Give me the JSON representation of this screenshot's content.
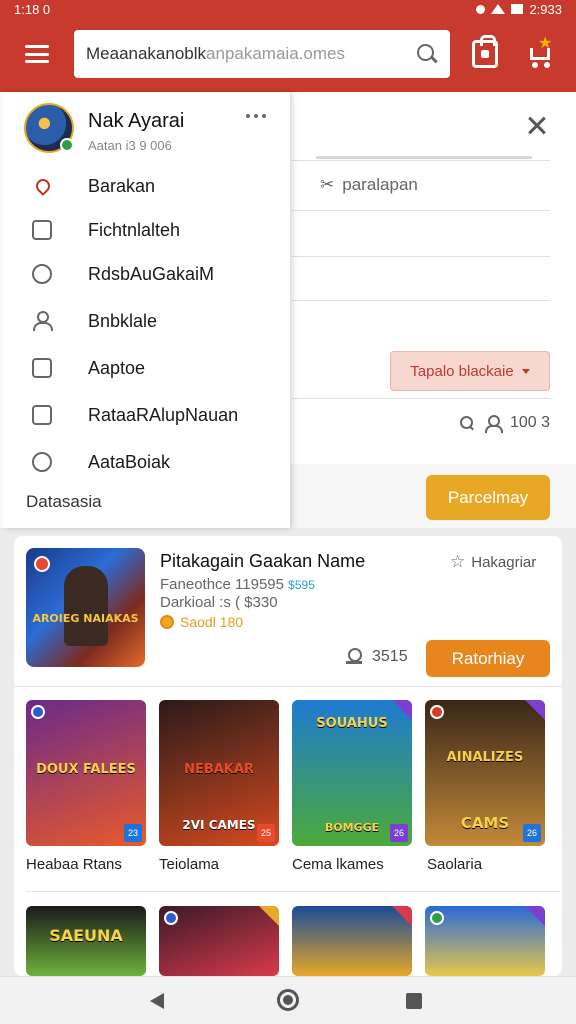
{
  "status_bar": {
    "time": "1:18 0",
    "battery": "2:933"
  },
  "app_bar": {
    "search_value": "Meaanakanoblk",
    "search_placeholder": "anpakamaia.omes"
  },
  "background_panel": {
    "filter_label": "paralapan",
    "sort_label": "Tapalo blackaie",
    "stat_value": "100 3",
    "primary_button": "Parcelmay"
  },
  "drawer": {
    "name": "Nak Ayarai",
    "subtitle": "Aatan i3 9 006",
    "items": [
      {
        "label": "Barakan",
        "icon": "pin-icon"
      },
      {
        "label": "Fichtnlalteh",
        "icon": "document-icon"
      },
      {
        "label": "RdsbAuGakaiM",
        "icon": "chat-icon"
      },
      {
        "label": "Bnbklale",
        "icon": "person-icon"
      },
      {
        "label": "Aaptoe",
        "icon": "image-icon"
      },
      {
        "label": "RataaRAlupNauan",
        "icon": "wallet-icon"
      },
      {
        "label": "AataBoiak",
        "icon": "settings-icon"
      }
    ],
    "footer": "Datasasia"
  },
  "featured": {
    "title": "Pitakagain Gaakan Name",
    "line1": "Faneothce 119595",
    "line1_accent": "$595",
    "line2": "Darkioal :s ( $330",
    "price": "Saodl 180",
    "meta": "Hakagriar",
    "count": "3515",
    "button": "Ratorhiay",
    "thumb_caption": "AROIEG NAIAKAS"
  },
  "games": [
    {
      "title": "DOUX FALEES",
      "label": "Heabaa Rtans",
      "badge": "23",
      "colors": [
        "#6a2a8a",
        "#e85a2a"
      ]
    },
    {
      "title": "NEBAKAR",
      "label": "Teiolama",
      "badge": "25",
      "colors": [
        "#2a1a1a",
        "#d44a1e"
      ]
    },
    {
      "title": "SOUAHUS",
      "label": "Cema lkames",
      "badge": "26",
      "colors": [
        "#1e7ad0",
        "#4caa3a"
      ]
    },
    {
      "title": "AINALIZES",
      "label": "Saolaria",
      "badge": "26",
      "colors": [
        "#3a2618",
        "#c28a3a"
      ]
    }
  ],
  "game_tile_captions": [
    "2VI CAMES",
    "BOMGGE",
    "CAMS"
  ],
  "more_games": [
    {
      "title": "SAEUNA",
      "colors": [
        "#1a1a1a",
        "#6fb13a"
      ]
    },
    {
      "title": "",
      "colors": [
        "#3a1a2a",
        "#d83a4a"
      ]
    },
    {
      "title": "",
      "colors": [
        "#1a4a9a",
        "#e8a828"
      ]
    },
    {
      "title": "",
      "colors": [
        "#2a6ad8",
        "#e8c84a"
      ]
    }
  ]
}
